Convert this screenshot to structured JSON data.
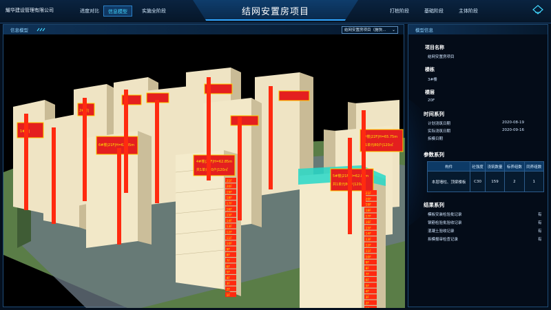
{
  "header": {
    "company": "耀华建设管理有限公司",
    "title": "结网安置房项目",
    "left_tabs": [
      {
        "label": "进度对比",
        "active": false
      },
      {
        "label": "信息模型",
        "active": true
      },
      {
        "label": "实施全阶段",
        "active": false
      }
    ],
    "right_tabs": [
      {
        "label": "打桩阶段"
      },
      {
        "label": "基础阶段"
      },
      {
        "label": "主体阶段"
      }
    ]
  },
  "left_panel": {
    "title": "信息模型",
    "select_value": "结网安置房项目（施快...",
    "building_signs": [
      {
        "text": "4#楼|21F|H=62.85m",
        "text2": "共1单元80户|120㎡"
      },
      {
        "text": "5#楼|21F|H=62.85m",
        "text2": "共1单元80户|120㎡"
      },
      {
        "text": "3#楼|22F|H=65.75m",
        "text2": "共1单元80户|120㎡"
      },
      {
        "text": "6#楼|21F|H=62.85m",
        "text2": ""
      },
      {
        "text": "1#楼|",
        "text2": ""
      },
      {
        "text": "2#楼|",
        "text2": ""
      }
    ],
    "floor_labels_4": [
      "21F",
      "20F",
      "19F",
      "18F",
      "17F",
      "16F",
      "15F",
      "14F",
      "13F",
      "12F",
      "11F",
      "10F",
      "9F",
      "8F",
      "7F",
      "6F",
      "5F",
      "4F",
      "3F",
      "2F",
      "1F"
    ],
    "floor_labels_5": [
      "21F",
      "20F",
      "19F",
      "18F",
      "17F",
      "16F",
      "15F",
      "14F",
      "13F",
      "12F",
      "11F",
      "10F",
      "9F",
      "8F",
      "7F",
      "6F",
      "5F",
      "4F",
      "3F",
      "2F",
      "1F"
    ]
  },
  "right_panel": {
    "title": "模型信息",
    "project_name_label": "项目名称",
    "project_name": "结网安置房项目",
    "building_label": "楼栋",
    "building": "3#楼",
    "floor_label": "楼层",
    "floor": "20F",
    "time_section": "时间系列",
    "time_rows": [
      {
        "label": "计划浇筑日期",
        "value": "2020-08-19"
      },
      {
        "label": "实际浇筑日期",
        "value": "2020-09-16"
      },
      {
        "label": "拆模日期",
        "value": ""
      }
    ],
    "param_section": "参数系列",
    "param_headers": [
      "构件",
      "砼强度",
      "浇筑数量",
      "标养组数",
      "同养组数"
    ],
    "param_row": [
      "本层墙柱、顶梁楼板",
      "C30",
      "159",
      "2",
      "1"
    ],
    "result_section": "结果系列",
    "result_rows": [
      {
        "label": "模板安装检验批记录",
        "value": "有"
      },
      {
        "label": "钢筋检验批验收记录",
        "value": "有"
      },
      {
        "label": "混凝土验收记录",
        "value": "有"
      },
      {
        "label": "拆模报审检查记录",
        "value": "有"
      }
    ]
  },
  "colors": {
    "accent": "#42d8ff",
    "sign_red": "#e41f1f",
    "sign_text": "#ffe600",
    "ground": "#5c7f4a"
  }
}
